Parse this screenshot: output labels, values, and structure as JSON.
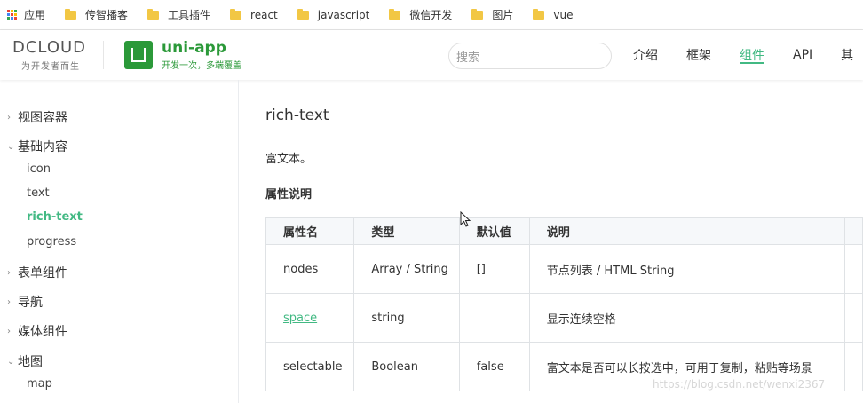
{
  "bookmarks": {
    "items": [
      {
        "label": "应用"
      },
      {
        "label": "传智播客"
      },
      {
        "label": "工具插件"
      },
      {
        "label": "react"
      },
      {
        "label": "javascript"
      },
      {
        "label": "微信开发"
      },
      {
        "label": "图片"
      },
      {
        "label": "vue"
      }
    ]
  },
  "header": {
    "dcloud_logo": "DCLOUD",
    "dcloud_slogan": "为开发者而生",
    "app_name": "uni-app",
    "app_slogan": "开发一次，多端覆盖",
    "search_placeholder": "搜索",
    "nav": [
      {
        "label": "介绍"
      },
      {
        "label": "框架"
      },
      {
        "label": "组件"
      },
      {
        "label": "API"
      },
      {
        "label": "其"
      }
    ]
  },
  "sidebar": {
    "groups": [
      {
        "label": "视图容器"
      },
      {
        "label": "基础内容"
      },
      {
        "label": "表单组件"
      },
      {
        "label": "导航"
      },
      {
        "label": "媒体组件"
      },
      {
        "label": "地图"
      }
    ],
    "subitems": [
      {
        "label": "icon"
      },
      {
        "label": "text"
      },
      {
        "label": "rich-text"
      },
      {
        "label": "progress"
      },
      {
        "label": "map"
      }
    ]
  },
  "main": {
    "title": "rich-text",
    "description": "富文本。",
    "section_title": "属性说明",
    "table": {
      "headers": [
        "属性名",
        "类型",
        "默认值",
        "说明"
      ],
      "rows": [
        [
          "nodes",
          "Array / String",
          "[]",
          "节点列表 / HTML String"
        ],
        [
          "space",
          "string",
          "",
          "显示连续空格"
        ],
        [
          "selectable",
          "Boolean",
          "false",
          "富文本是否可以长按选中，可用于复制，粘贴等场景"
        ]
      ]
    }
  },
  "watermark": "https://blog.csdn.net/wenxi2367",
  "colors": {
    "accent": "#42b983",
    "brand": "#2b9939"
  }
}
